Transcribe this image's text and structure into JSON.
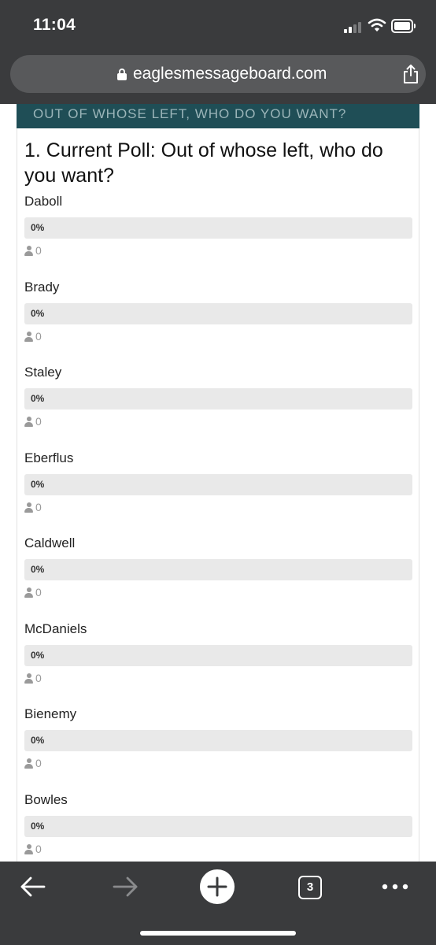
{
  "status_bar": {
    "time": "11:04",
    "icons": [
      "signal-icon",
      "wifi-icon",
      "battery-icon"
    ]
  },
  "browser": {
    "url": "eaglesmessageboard.com",
    "lock_icon": "lock-icon",
    "share_icon": "share-icon",
    "toolbar": {
      "tabs_count": "3",
      "icons": [
        "back-arrow-icon",
        "forward-arrow-icon",
        "plus-circle-icon",
        "tabs-icon",
        "more-icon"
      ]
    }
  },
  "poll": {
    "header": "OUT OF WHOSE LEFT, WHO DO YOU WANT?",
    "question": "1. Current Poll: Out of whose left, who do you want?",
    "options": [
      {
        "name": "Daboll",
        "percent_label": "0%",
        "percent": 0,
        "votes": "0"
      },
      {
        "name": "Brady",
        "percent_label": "0%",
        "percent": 0,
        "votes": "0"
      },
      {
        "name": "Staley",
        "percent_label": "0%",
        "percent": 0,
        "votes": "0"
      },
      {
        "name": "Eberflus",
        "percent_label": "0%",
        "percent": 0,
        "votes": "0"
      },
      {
        "name": "Caldwell",
        "percent_label": "0%",
        "percent": 0,
        "votes": "0"
      },
      {
        "name": "McDaniels",
        "percent_label": "0%",
        "percent": 0,
        "votes": "0"
      },
      {
        "name": "Bienemy",
        "percent_label": "0%",
        "percent": 0,
        "votes": "0"
      },
      {
        "name": "Bowles",
        "percent_label": "0%",
        "percent": 0,
        "votes": "0"
      }
    ]
  },
  "colors": {
    "chrome": "#3a3b3d",
    "url_pill": "#58595b",
    "poll_header": "#1f4e56",
    "bar_track": "#e9e9e9",
    "vote_icon": "#9a9a9a"
  }
}
